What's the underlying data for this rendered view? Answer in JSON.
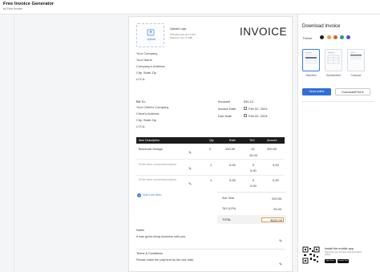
{
  "app": {
    "title": "Free Invoice Generator",
    "subtitle": "by Zoho Invoice"
  },
  "logo": {
    "button": "Upload",
    "title": "Upload Logo",
    "line1": "240x240 pixels @ 72 DPI,",
    "line2": "Maximum size of 1MB."
  },
  "doc_title": "INVOICE",
  "from": {
    "company": "Your Company",
    "name": "Your Name",
    "address": "Company's Address",
    "city": "City, State Zip",
    "country": "U.S.A"
  },
  "bill_to": {
    "label": "Bill To:",
    "client_company": "Your Client's Company",
    "client_address": "Client's Address",
    "city": "City, State Zip",
    "country": "U.S.A"
  },
  "meta": {
    "invoice_label": "Invoice#",
    "invoice_value": "INV-12",
    "date_label": "Invoice Date",
    "date_value": "Feb 02, 2024",
    "due_label": "Due Date",
    "due_value": "Feb 02, 2024"
  },
  "table": {
    "headers": [
      "Item Description",
      "Qty",
      "Rate",
      "TAX",
      "Amount"
    ],
    "rows": [
      {
        "desc": "Brochure Design",
        "qty": "2",
        "rate": "100.00",
        "tax": "12",
        "tax_amount": "24.00",
        "amount": "200.00"
      },
      {
        "desc": "",
        "placeholder": "Enter item name/description",
        "qty": "1",
        "rate": "0.00",
        "tax": "0",
        "tax_amount": "0.00",
        "amount": "0.00"
      },
      {
        "desc": "",
        "placeholder": "Enter item name/description",
        "qty": "1",
        "rate": "0.00",
        "tax": "0",
        "tax_amount": "0.00",
        "amount": "0.00"
      }
    ],
    "add_line": "Add Line Item"
  },
  "totals": {
    "subtotal_label": "Sub Total",
    "subtotal": "200.00",
    "tax_label": "TAX (12%)",
    "tax": "24.00",
    "total_label": "TOTAL",
    "total_prefix": "$",
    "total": "224.00"
  },
  "notes": {
    "label": "Notes",
    "text": "It was great doing business with you."
  },
  "terms": {
    "label": "Terms & Conditions",
    "text": "Please make the payment by the due date."
  },
  "side": {
    "title": "Download Invoice",
    "theme_label": "Theme",
    "theme_colors": [
      "#1f1f1f",
      "#e8a23a",
      "#e05a3c",
      "#2e9b6b",
      "#4a57c9"
    ],
    "templates": [
      "Standard",
      "Spreadsheet",
      "Compact"
    ],
    "email_button": "Send online",
    "download_button": "Download/Print",
    "app_title": "Install the mobile app",
    "app_desc1": "Generate your invoices and send them",
    "app_desc2": "online.",
    "store1": "App Store",
    "store2": "Google Play"
  }
}
